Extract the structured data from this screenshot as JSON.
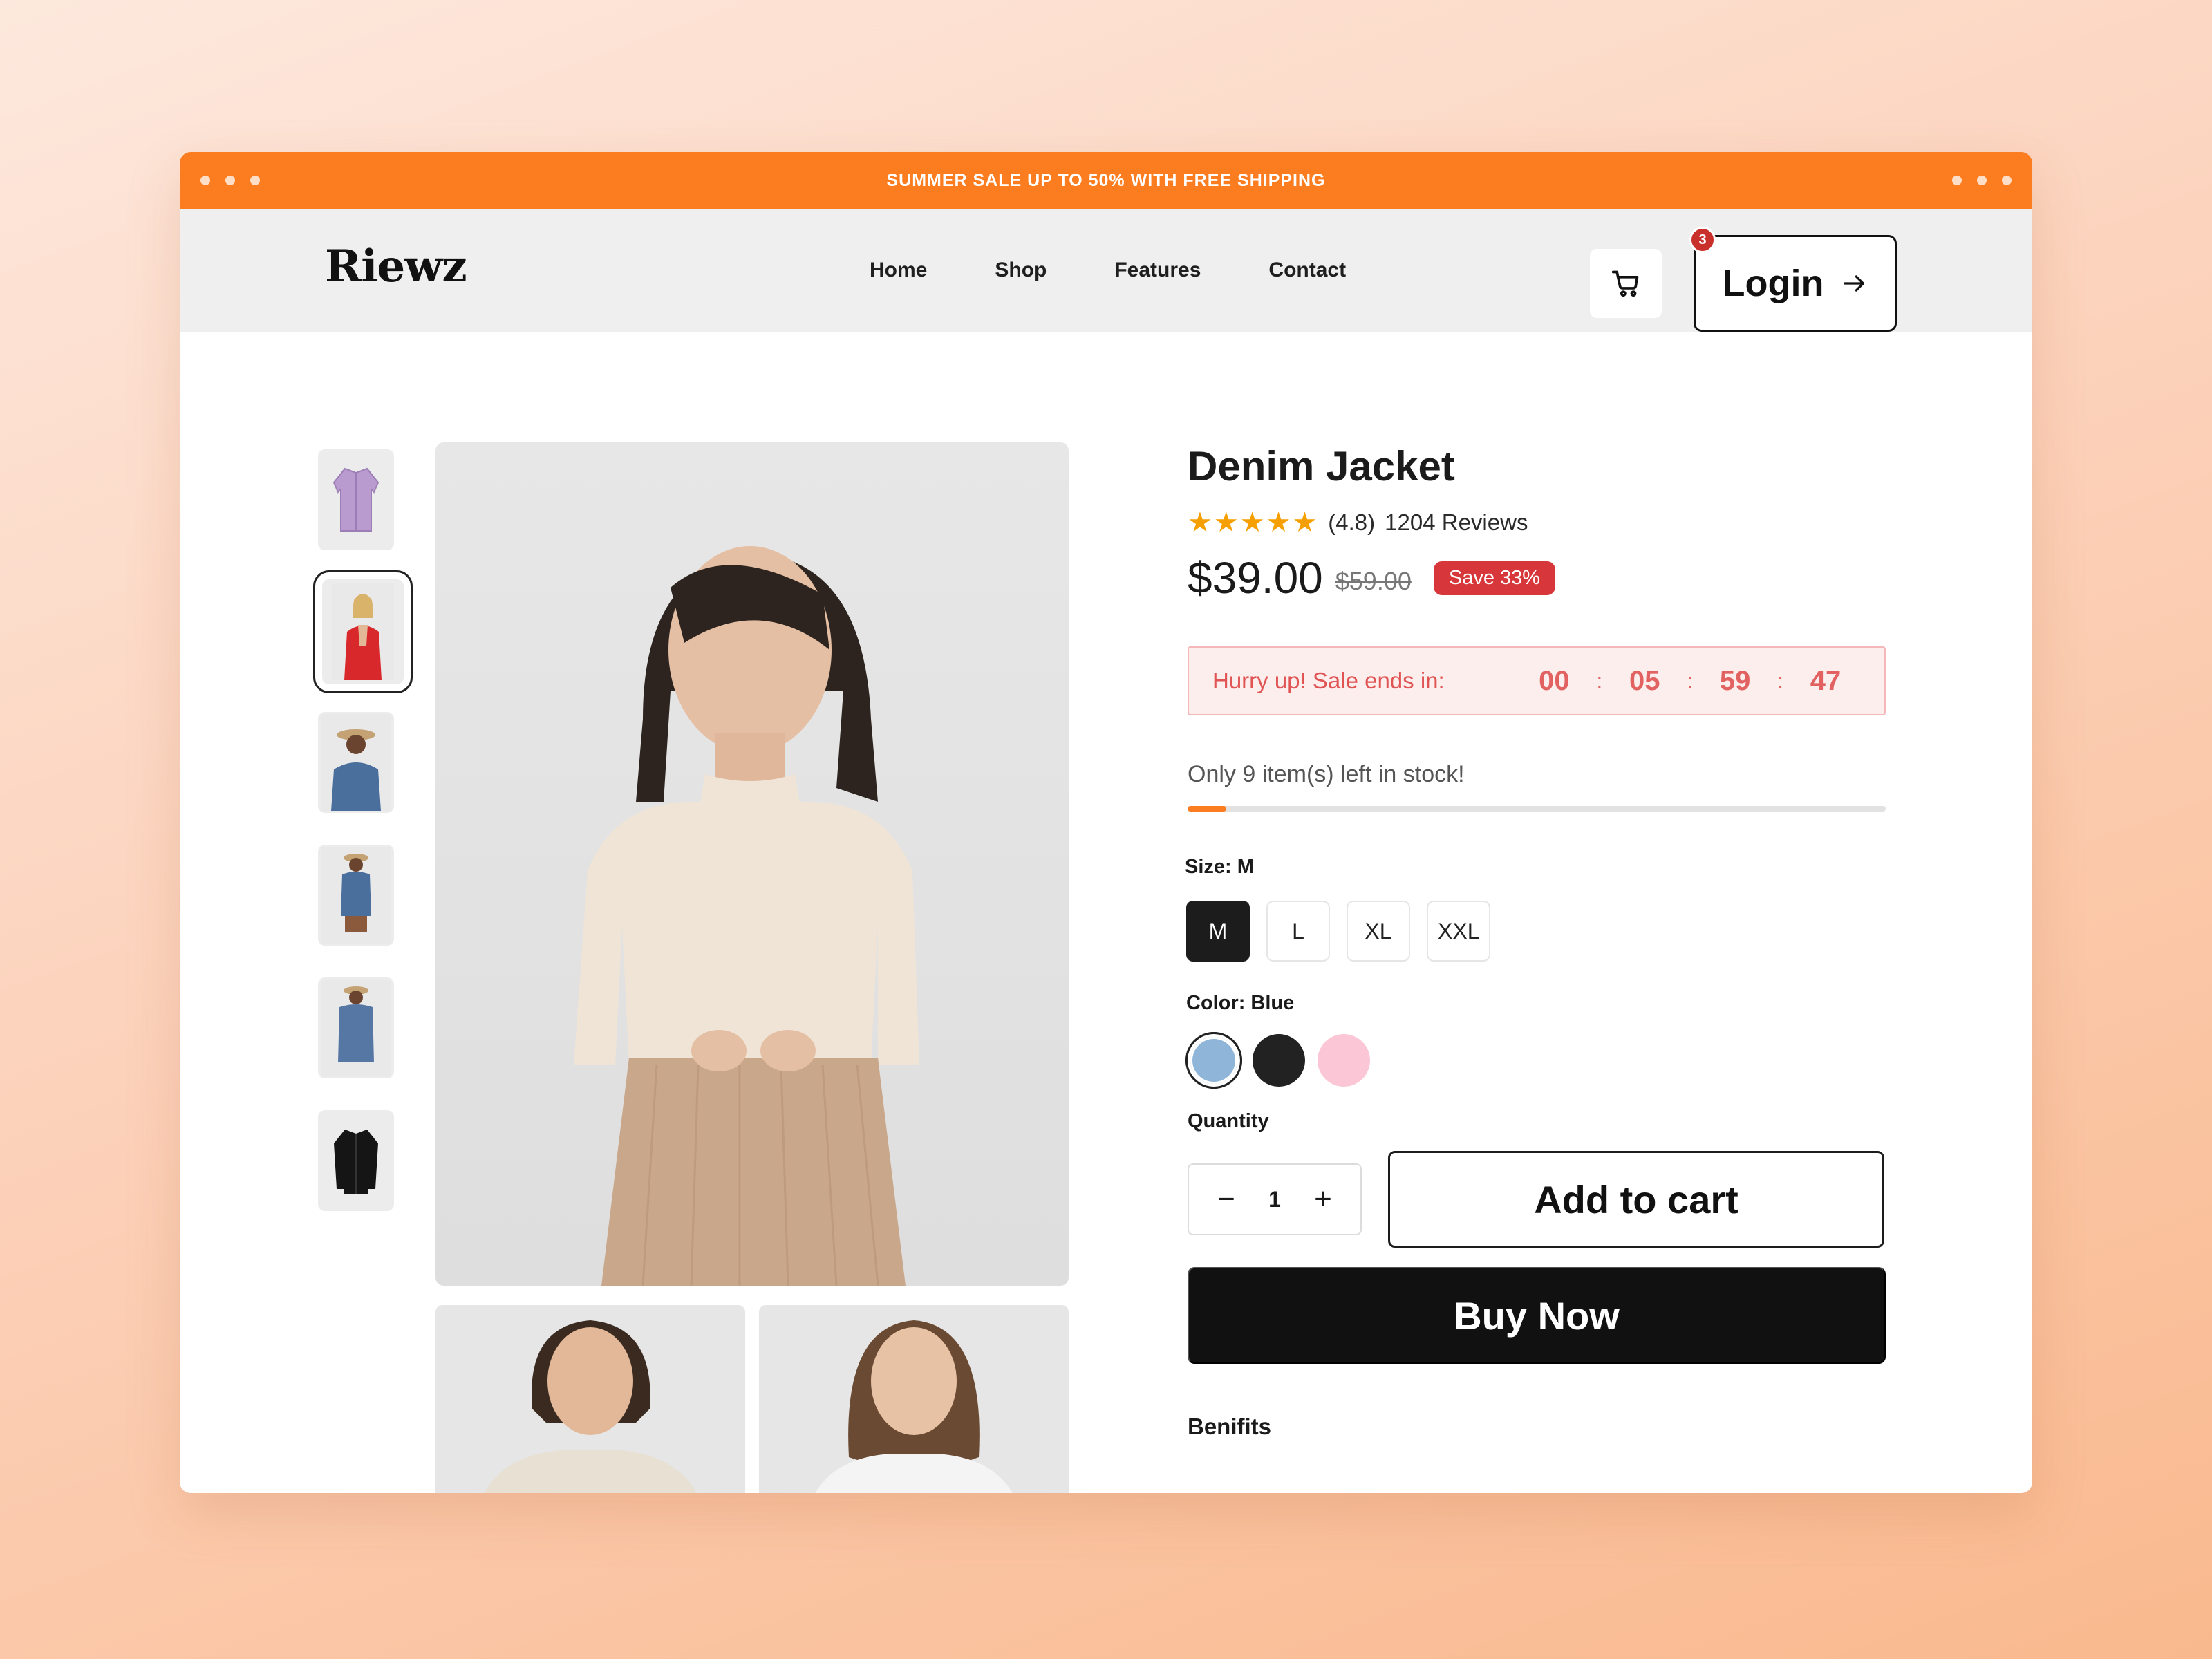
{
  "promo": {
    "text": "SUMMER SALE UP TO 50% WITH FREE SHIPPING"
  },
  "header": {
    "logo": "Riewz",
    "nav": [
      "Home",
      "Shop",
      "Features",
      "Contact"
    ],
    "cart_count": "3",
    "login_label": "Login"
  },
  "gallery": {
    "active_thumbnail": 1,
    "thumbnails": [
      "lavender-shirt",
      "red-jacket-model",
      "denim-jacket-hat-model",
      "denim-jacket-skirt-model",
      "denim-jacket-back-model",
      "black-jacket"
    ]
  },
  "product": {
    "title": "Denim Jacket",
    "rating": "(4.8)",
    "reviews": "1204 Reviews",
    "price": "$39.00",
    "old_price": "$59.00",
    "save_badge": "Save 33%",
    "sale_label": "Hurry up! Sale ends in:",
    "timer": [
      "00",
      "05",
      "59",
      "47"
    ],
    "stock_text": "Only 9 item(s) left in stock!",
    "stock_level": 0.055,
    "size_label": "Size: M",
    "sizes": [
      "M",
      "L",
      "XL",
      "XXL"
    ],
    "selected_size": "M",
    "color_label": "Color: Blue",
    "colors": [
      {
        "name": "Blue",
        "hex": "#8fb5d9"
      },
      {
        "name": "Black",
        "hex": "#222222"
      },
      {
        "name": "Pink",
        "hex": "#fbc7d6"
      }
    ],
    "quantity_label": "Quantity",
    "quantity": "1",
    "add_to_cart_label": "Add to cart",
    "buy_now_label": "Buy Now",
    "benefits_label": "Benifits"
  },
  "colors": {
    "accent": "#fb7d20",
    "sale_red": "#d7373a",
    "star": "#f5a000"
  }
}
